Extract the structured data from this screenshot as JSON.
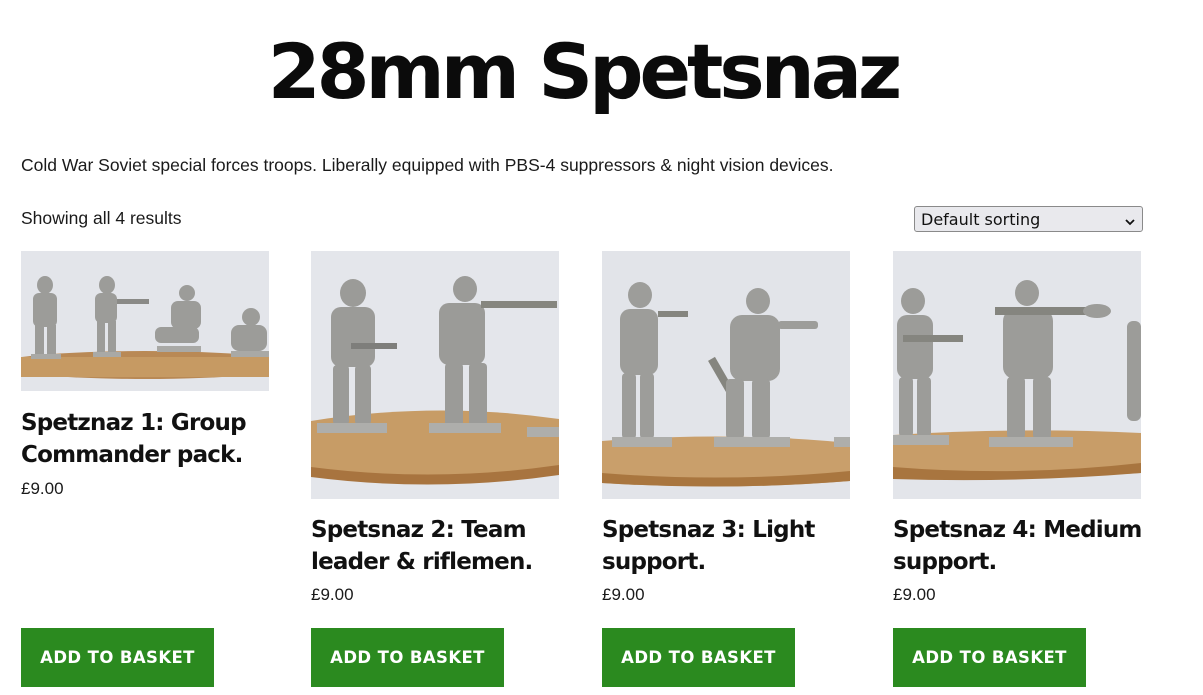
{
  "page": {
    "title": "28mm Spetsnaz",
    "description": "Cold War Soviet special forces troops. Liberally equipped with PBS-4 suppressors & night vision devices.",
    "result_count": "Showing all 4 results",
    "sort": {
      "selected": "Default sorting",
      "icon": "chevron-down-icon"
    }
  },
  "products": [
    {
      "title": "Spetznaz 1: Group Commander pack.",
      "price": "£9.00",
      "button": "ADD TO BASKET"
    },
    {
      "title": "Spetsnaz 2: Team leader & riflemen.",
      "price": "£9.00",
      "button": "ADD TO BASKET"
    },
    {
      "title": "Spetsnaz 3: Light support.",
      "price": "£9.00",
      "button": "ADD TO BASKET"
    },
    {
      "title": "Spetsnaz 4: Medium support.",
      "price": "£9.00",
      "button": "ADD TO BASKET"
    }
  ],
  "colors": {
    "button_green": "#2b8a1f",
    "photo_background": "#e6e8ed",
    "base_wood": "#c9a06a",
    "miniature_pewter": "#9a9a98"
  }
}
